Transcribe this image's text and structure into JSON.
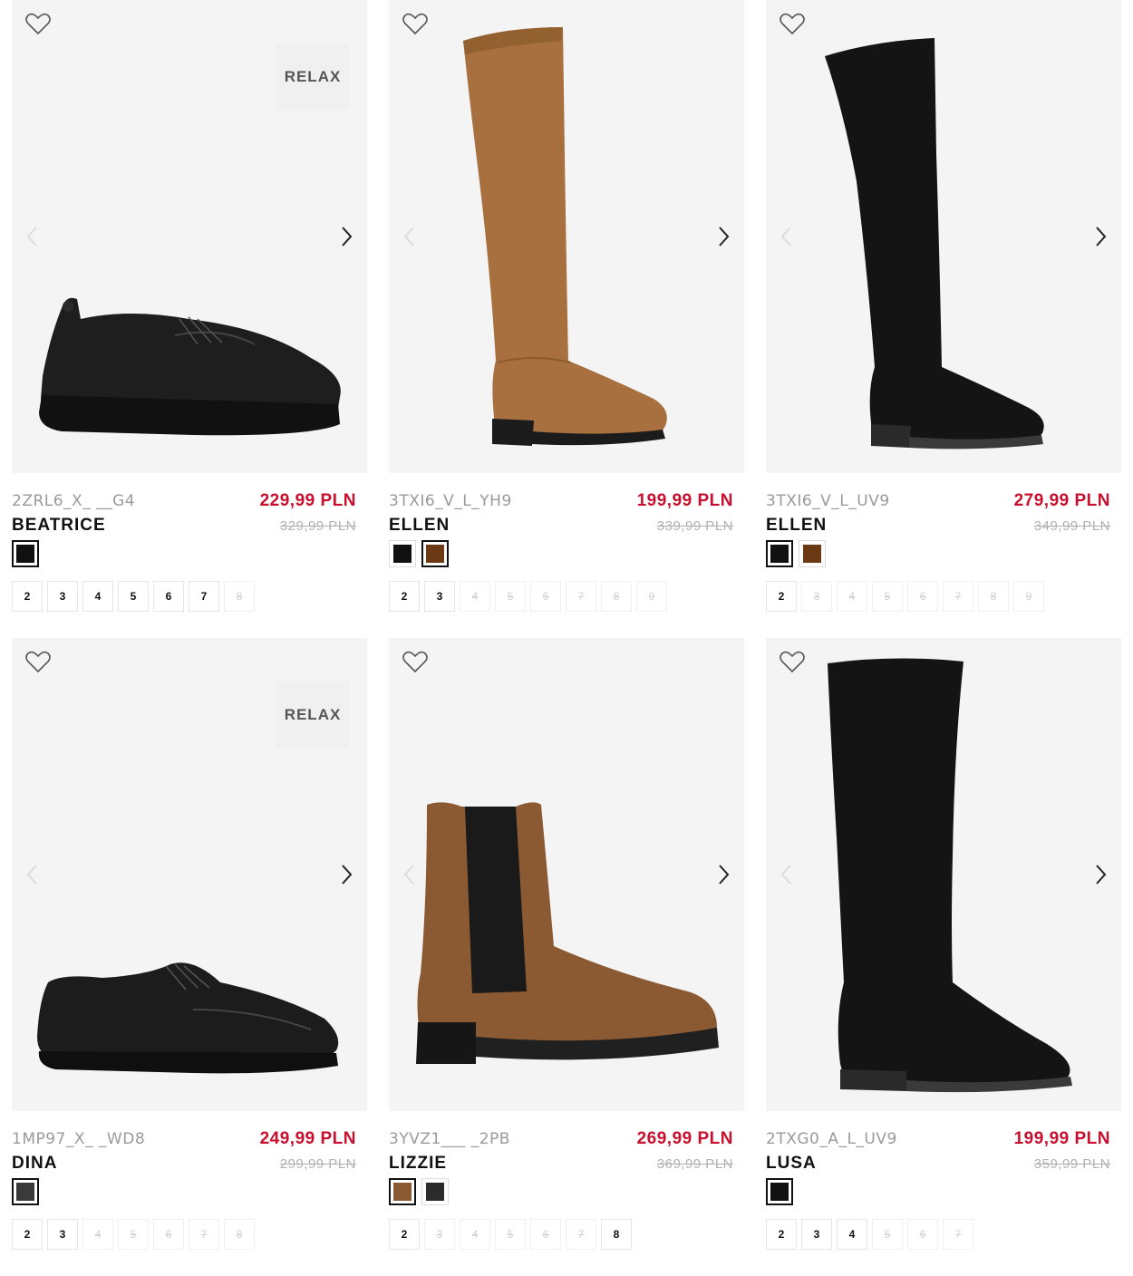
{
  "products": [
    {
      "code": "2ZRL6_X_ __G4",
      "name": "BEATRICE",
      "price": "229,99 PLN",
      "old_price": "329,99 PLN",
      "badge": "RELAX",
      "swatches": [
        {
          "color": "#111111",
          "selected": true
        }
      ],
      "sizes": [
        {
          "label": "2",
          "available": true
        },
        {
          "label": "3",
          "available": true
        },
        {
          "label": "4",
          "available": true
        },
        {
          "label": "5",
          "available": true
        },
        {
          "label": "6",
          "available": true
        },
        {
          "label": "7",
          "available": true
        },
        {
          "label": "8",
          "available": false
        }
      ],
      "image_icon": "black-leather-wedge-shoe-image"
    },
    {
      "code": "3TXI6_V_L_YH9",
      "name": "ELLEN",
      "price": "199,99 PLN",
      "old_price": "339,99 PLN",
      "swatches": [
        {
          "color": "#111111",
          "selected": false
        },
        {
          "color": "#6b3a14",
          "selected": true
        }
      ],
      "sizes": [
        {
          "label": "2",
          "available": true
        },
        {
          "label": "3",
          "available": true
        },
        {
          "label": "4",
          "available": false
        },
        {
          "label": "5",
          "available": false
        },
        {
          "label": "6",
          "available": false
        },
        {
          "label": "7",
          "available": false
        },
        {
          "label": "8",
          "available": false
        },
        {
          "label": "9",
          "available": false
        }
      ],
      "image_icon": "brown-over-knee-boot-image"
    },
    {
      "code": "3TXI6_V_L_UV9",
      "name": "ELLEN",
      "price": "279,99 PLN",
      "old_price": "349,99 PLN",
      "swatches": [
        {
          "color": "#111111",
          "selected": true
        },
        {
          "color": "#6b3a14",
          "selected": false
        }
      ],
      "sizes": [
        {
          "label": "2",
          "available": true
        },
        {
          "label": "3",
          "available": false
        },
        {
          "label": "4",
          "available": false
        },
        {
          "label": "5",
          "available": false
        },
        {
          "label": "6",
          "available": false
        },
        {
          "label": "7",
          "available": false
        },
        {
          "label": "8",
          "available": false
        },
        {
          "label": "9",
          "available": false
        }
      ],
      "image_icon": "black-over-knee-boot-image"
    },
    {
      "code": "1MP97_X_ _WD8",
      "name": "DINA",
      "price": "249,99 PLN",
      "old_price": "299,99 PLN",
      "badge": "RELAX",
      "swatches": [
        {
          "color": "#3a3a3a",
          "selected": true
        }
      ],
      "sizes": [
        {
          "label": "2",
          "available": true
        },
        {
          "label": "3",
          "available": true
        },
        {
          "label": "4",
          "available": false
        },
        {
          "label": "5",
          "available": false
        },
        {
          "label": "6",
          "available": false
        },
        {
          "label": "7",
          "available": false
        },
        {
          "label": "8",
          "available": false
        }
      ],
      "image_icon": "black-leather-lace-up-shoe-image"
    },
    {
      "code": "3YVZ1___ _2PB",
      "name": "LIZZIE",
      "price": "269,99 PLN",
      "old_price": "369,99 PLN",
      "swatches": [
        {
          "color": "#8a5a35",
          "selected": true
        },
        {
          "color": "#2b2b2b",
          "selected": false
        }
      ],
      "sizes": [
        {
          "label": "2",
          "available": true
        },
        {
          "label": "3",
          "available": false
        },
        {
          "label": "4",
          "available": false
        },
        {
          "label": "5",
          "available": false
        },
        {
          "label": "6",
          "available": false
        },
        {
          "label": "7",
          "available": false
        },
        {
          "label": "8",
          "available": true
        }
      ],
      "image_icon": "brown-chelsea-boot-image"
    },
    {
      "code": "2TXG0_A_L_UV9",
      "name": "LUSA",
      "price": "199,99 PLN",
      "old_price": "359,99 PLN",
      "swatches": [
        {
          "color": "#111111",
          "selected": true
        }
      ],
      "sizes": [
        {
          "label": "2",
          "available": true
        },
        {
          "label": "3",
          "available": true
        },
        {
          "label": "4",
          "available": true
        },
        {
          "label": "5",
          "available": false
        },
        {
          "label": "6",
          "available": false
        },
        {
          "label": "7",
          "available": false
        }
      ],
      "image_icon": "black-knee-high-boot-image"
    }
  ]
}
